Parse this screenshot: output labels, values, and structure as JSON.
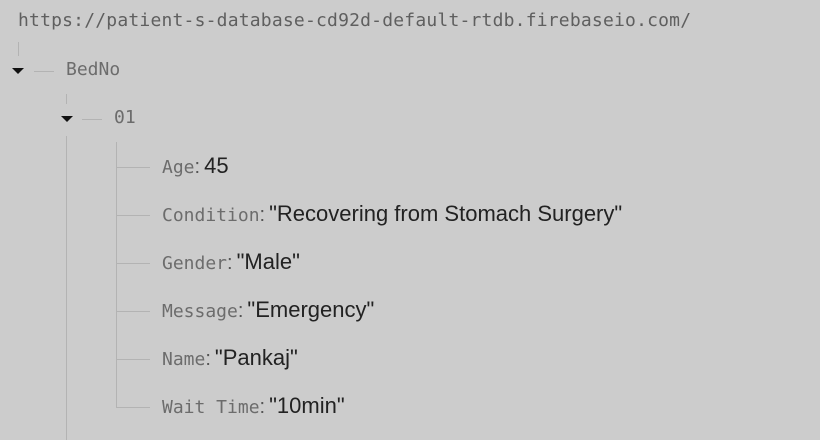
{
  "root": {
    "url": "https://patient-s-database-cd92d-default-rtdb.firebaseio.com/"
  },
  "tree": {
    "bedno": {
      "key": "BedNo",
      "expanded": true,
      "child": {
        "key": "01",
        "expanded": true,
        "fields": [
          {
            "key": "Age",
            "separator": ":",
            "value": "45"
          },
          {
            "key": "Condition",
            "separator": ":",
            "value": "\"Recovering from Stomach Surgery\""
          },
          {
            "key": "Gender",
            "separator": ":",
            "value": "\"Male\""
          },
          {
            "key": "Message",
            "separator": ":",
            "value": "\"Emergency\""
          },
          {
            "key": "Name",
            "separator": ":",
            "value": "\"Pankaj\""
          },
          {
            "key": "Wait Time",
            "separator": ":",
            "value": "\"10min\""
          }
        ]
      }
    }
  }
}
